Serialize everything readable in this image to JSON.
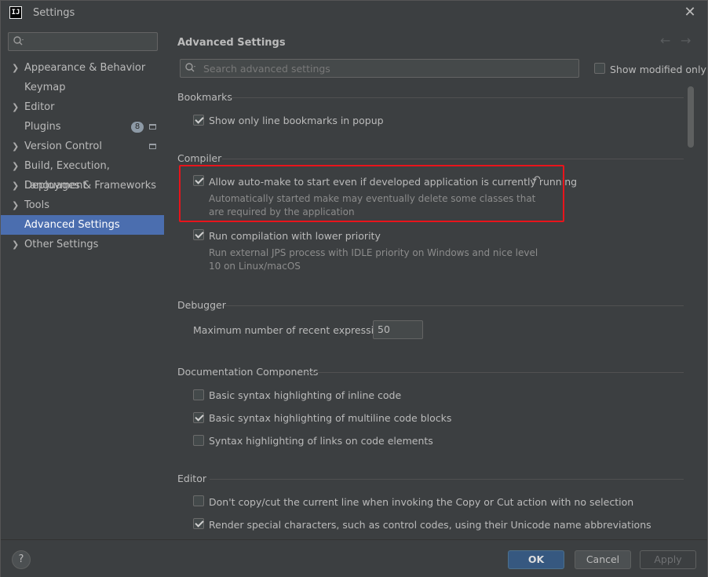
{
  "window": {
    "title": "Settings",
    "app_icon_text": "IJ"
  },
  "sidebar": {
    "search_placeholder": "",
    "items": [
      {
        "label": "Appearance & Behavior",
        "expandable": true
      },
      {
        "label": "Keymap",
        "expandable": false
      },
      {
        "label": "Editor",
        "expandable": true
      },
      {
        "label": "Plugins",
        "expandable": false,
        "badge": "8"
      },
      {
        "label": "Version Control",
        "expandable": true
      },
      {
        "label": "Build, Execution, Deployment",
        "expandable": true
      },
      {
        "label": "Languages & Frameworks",
        "expandable": true
      },
      {
        "label": "Tools",
        "expandable": true
      },
      {
        "label": "Advanced Settings",
        "expandable": false,
        "selected": true
      },
      {
        "label": "Other Settings",
        "expandable": true
      }
    ]
  },
  "main": {
    "title": "Advanced Settings",
    "search_placeholder": "Search advanced settings",
    "show_modified_label": "Show modified only",
    "sections": {
      "bookmarks": {
        "title": "Bookmarks",
        "opt1": "Show only line bookmarks in popup"
      },
      "compiler": {
        "title": "Compiler",
        "opt1": "Allow auto-make to start even if developed application is currently running",
        "opt1_desc1": "Automatically started make may eventually delete some classes that",
        "opt1_desc2": "are required by the application",
        "opt2": "Run compilation with lower priority",
        "opt2_desc1": "Run external JPS process with IDLE priority on Windows and nice level",
        "opt2_desc2": "10 on Linux/macOS"
      },
      "debugger": {
        "title": "Debugger",
        "max_expr_label": "Maximum number of recent expressions:",
        "max_expr_value": "50"
      },
      "doc": {
        "title": "Documentation Components",
        "opt1": "Basic syntax highlighting of inline code",
        "opt2": "Basic syntax highlighting of multiline code blocks",
        "opt3": "Syntax highlighting of links on code elements"
      },
      "editor": {
        "title": "Editor",
        "opt1": "Don't copy/cut the current line when invoking the Copy or Cut action with no selection",
        "opt2": "Render special characters, such as control codes, using their Unicode name abbreviations"
      }
    }
  },
  "footer": {
    "help": "?",
    "ok": "OK",
    "cancel": "Cancel",
    "apply": "Apply"
  },
  "colors": {
    "selection": "#4b6eaf",
    "highlight_border": "#e8141b",
    "ok_button": "#365880"
  }
}
